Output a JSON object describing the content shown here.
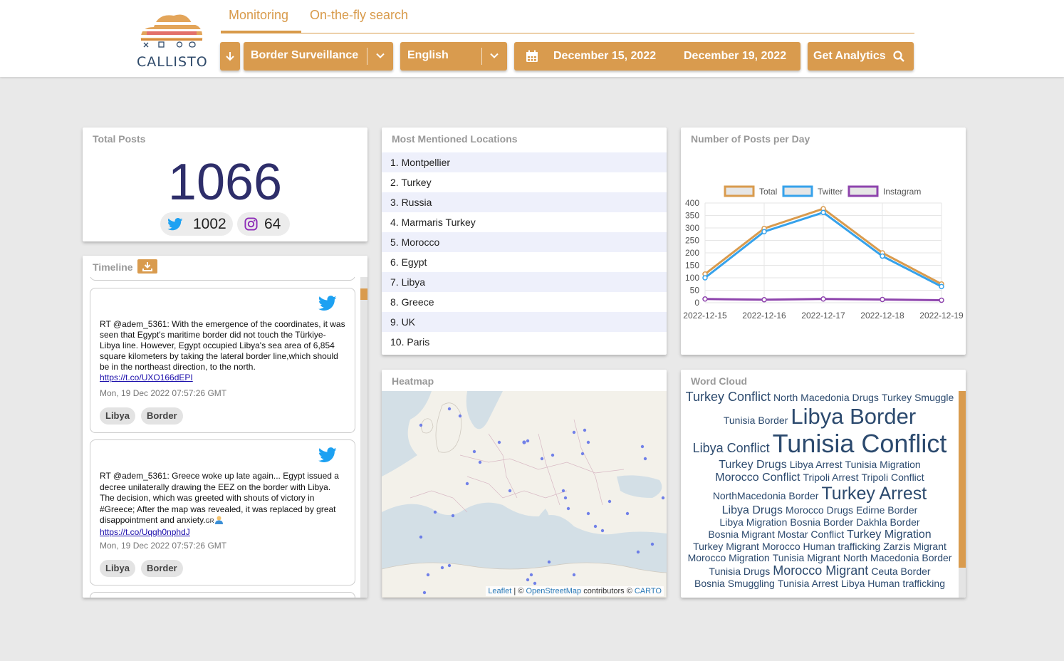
{
  "app": {
    "logo_text": "CALLISTO"
  },
  "tabs": [
    {
      "label": "Monitoring"
    },
    {
      "label": "On-the-fly search"
    }
  ],
  "toolbar": {
    "topic": "Border Surveillance",
    "language": "English",
    "date_from": "December 15, 2022",
    "date_to": "December 19, 2022",
    "analytics_label": "Get Analytics"
  },
  "total_posts": {
    "title": "Total Posts",
    "count": "1066",
    "twitter_count": "1002",
    "instagram_count": "64"
  },
  "locations": {
    "title": "Most Mentioned Locations",
    "items": [
      "1. Montpellier",
      "2. Turkey",
      "3. Russia",
      "4. Marmaris Turkey",
      "5. Morocco",
      "6. Egypt",
      "7. Libya",
      "8. Greece",
      "9. UK",
      "10. Paris"
    ]
  },
  "posts_per_day": {
    "title": "Number of Posts per Day"
  },
  "chart_data": {
    "type": "line",
    "x": [
      "2022-12-15",
      "2022-12-16",
      "2022-12-17",
      "2022-12-18",
      "2022-12-19"
    ],
    "ylim": [
      0,
      400
    ],
    "yticks": [
      0,
      50,
      100,
      150,
      200,
      250,
      300,
      350,
      400
    ],
    "series": [
      {
        "name": "Total",
        "color": "#d99b4e",
        "values": [
          115,
          298,
          377,
          200,
          75
        ]
      },
      {
        "name": "Twitter",
        "color": "#36a2eb",
        "values": [
          100,
          285,
          362,
          187,
          65
        ]
      },
      {
        "name": "Instagram",
        "color": "#8e44ad",
        "values": [
          15,
          12,
          15,
          13,
          10
        ]
      }
    ],
    "legend": "top",
    "grid": true
  },
  "timeline": {
    "title": "Timeline",
    "posts": [
      {
        "text": "RT @adem_5361: With the emergence of the coordinates, it was seen that Egypt's maritime border did not touch the Türkiye-Libya line. However, Egypt occupied Libya's sea area of 6,854 square kilometers by taking the lateral border line,which should be in the northeast direction, to the north.",
        "link": "https://t.co/UXO166dEPI",
        "date": "Mon, 19 Dec 2022 07:57:26 GMT",
        "tags": [
          "Libya",
          "Border"
        ]
      },
      {
        "text": "RT @adem_5361: Greece woke up late again... Egypt issued a decree unilaterally drawing the EEZ on the border with Libya. The decision, which was greeted with shouts of victory in #Greece; After the map was revealed, it was replaced by great disappointment and anxiety.",
        "flag": "GR",
        "link": "https://t.co/Uqgh0nphdJ",
        "date": "Mon, 19 Dec 2022 07:57:26 GMT",
        "tags": [
          "Libya",
          "Border"
        ]
      }
    ]
  },
  "heatmap": {
    "title": "Heatmap",
    "attribution_leaflet": "Leaflet",
    "attribution_sep": " | © ",
    "attribution_osm": "OpenStreetMap",
    "attribution_mid": " contributors © ",
    "attribution_carto": "CARTO"
  },
  "word_cloud": {
    "title": "Word Cloud",
    "lines": [
      [
        {
          "w": "Turkey Conflict",
          "s": 18
        },
        {
          "w": "North Macedonia Drugs",
          "s": 14
        },
        {
          "w": "Turkey Smuggle",
          "s": 14
        }
      ],
      [
        {
          "w": "Tunisia Border",
          "s": 14
        },
        {
          "w": "Libya Border",
          "s": 31
        }
      ],
      [
        {
          "w": "Libya Conflict",
          "s": 18
        },
        {
          "w": "Tunisia Conflict",
          "s": 36
        }
      ],
      [
        {
          "w": "Turkey Drugs",
          "s": 16
        },
        {
          "w": "Libya Arrest",
          "s": 14
        },
        {
          "w": "Tunisia Migration",
          "s": 14
        }
      ],
      [
        {
          "w": "Morocco Conflict",
          "s": 16
        },
        {
          "w": "Tripoli Arrest",
          "s": 14
        },
        {
          "w": "Tripoli Conflict",
          "s": 14
        }
      ],
      [
        {
          "w": "NorthMacedonia Border",
          "s": 14
        },
        {
          "w": "Turkey Arrest",
          "s": 25
        }
      ],
      [
        {
          "w": "Libya Drugs",
          "s": 16
        },
        {
          "w": "Morocco Drugs",
          "s": 14
        },
        {
          "w": "Edirne Border",
          "s": 14
        }
      ],
      [
        {
          "w": "Libya Migration",
          "s": 14
        },
        {
          "w": "Bosnia Border",
          "s": 14
        },
        {
          "w": "Dakhla Border",
          "s": 14
        }
      ],
      [
        {
          "w": "Bosnia Migrant",
          "s": 14
        },
        {
          "w": "Mostar Conflict",
          "s": 14
        },
        {
          "w": "Turkey Migration",
          "s": 16
        }
      ],
      [
        {
          "w": "Turkey Migrant",
          "s": 14
        },
        {
          "w": "Morocco Human trafficking",
          "s": 14
        },
        {
          "w": "Zarzis Migrant",
          "s": 14
        }
      ],
      [
        {
          "w": "Morocco Migration",
          "s": 14
        },
        {
          "w": "Tunisia Migrant",
          "s": 14
        },
        {
          "w": "North Macedonia Border",
          "s": 14
        }
      ],
      [
        {
          "w": "Tunisia Drugs",
          "s": 14
        },
        {
          "w": "Morocco Migrant",
          "s": 18
        },
        {
          "w": "Ceuta Border",
          "s": 14
        }
      ],
      [
        {
          "w": "Bosnia Smuggling",
          "s": 14
        },
        {
          "w": "Tunisia Arrest",
          "s": 14
        },
        {
          "w": "Libya Human trafficking",
          "s": 14
        }
      ]
    ]
  }
}
